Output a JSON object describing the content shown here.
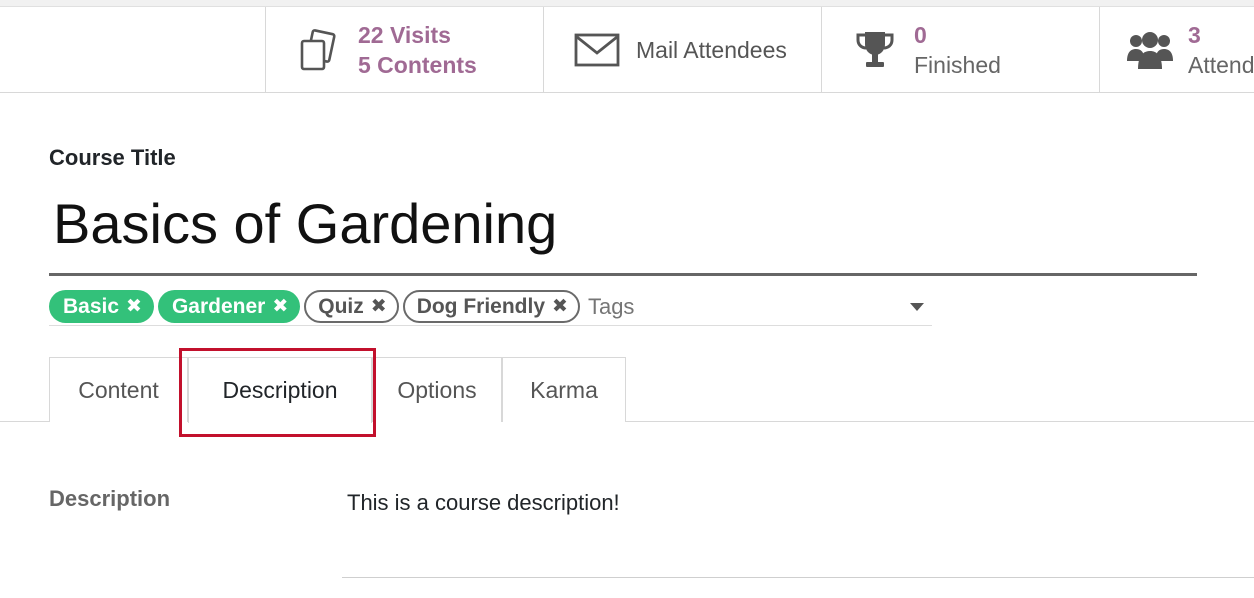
{
  "stats": {
    "visits": {
      "line1": "22 Visits",
      "line2": "5 Contents",
      "icon": "copy-icon"
    },
    "mail": {
      "label": "Mail Attendees",
      "icon": "envelope-icon"
    },
    "finished": {
      "value": "0",
      "label": "Finished",
      "icon": "trophy-icon"
    },
    "attendees": {
      "value": "3",
      "label": "Attendees",
      "icon": "users-icon"
    }
  },
  "course": {
    "title_label": "Course Title",
    "title": "Basics of Gardening"
  },
  "tags": {
    "items": [
      {
        "label": "Basic",
        "style": "green"
      },
      {
        "label": "Gardener",
        "style": "green"
      },
      {
        "label": "Quiz",
        "style": "outline"
      },
      {
        "label": "Dog Friendly",
        "style": "outline"
      }
    ],
    "remove_glyph": "✖",
    "placeholder": "Tags"
  },
  "tabs": [
    {
      "label": "Content"
    },
    {
      "label": "Description",
      "active": true
    },
    {
      "label": "Options"
    },
    {
      "label": "Karma"
    }
  ],
  "description": {
    "label": "Description",
    "value": "This is a course description!"
  },
  "colors": {
    "accent": "#a06a94",
    "tag_green": "#33c17a",
    "highlight": "#c2102c"
  }
}
